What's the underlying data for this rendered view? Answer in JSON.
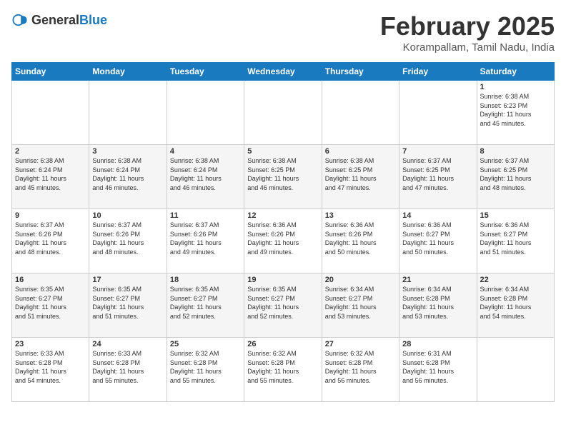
{
  "header": {
    "logo_general": "General",
    "logo_blue": "Blue",
    "title": "February 2025",
    "subtitle": "Korampallam, Tamil Nadu, India"
  },
  "weekdays": [
    "Sunday",
    "Monday",
    "Tuesday",
    "Wednesday",
    "Thursday",
    "Friday",
    "Saturday"
  ],
  "weeks": [
    [
      {
        "day": "",
        "info": ""
      },
      {
        "day": "",
        "info": ""
      },
      {
        "day": "",
        "info": ""
      },
      {
        "day": "",
        "info": ""
      },
      {
        "day": "",
        "info": ""
      },
      {
        "day": "",
        "info": ""
      },
      {
        "day": "1",
        "info": "Sunrise: 6:38 AM\nSunset: 6:23 PM\nDaylight: 11 hours\nand 45 minutes."
      }
    ],
    [
      {
        "day": "2",
        "info": "Sunrise: 6:38 AM\nSunset: 6:24 PM\nDaylight: 11 hours\nand 45 minutes."
      },
      {
        "day": "3",
        "info": "Sunrise: 6:38 AM\nSunset: 6:24 PM\nDaylight: 11 hours\nand 46 minutes."
      },
      {
        "day": "4",
        "info": "Sunrise: 6:38 AM\nSunset: 6:24 PM\nDaylight: 11 hours\nand 46 minutes."
      },
      {
        "day": "5",
        "info": "Sunrise: 6:38 AM\nSunset: 6:25 PM\nDaylight: 11 hours\nand 46 minutes."
      },
      {
        "day": "6",
        "info": "Sunrise: 6:38 AM\nSunset: 6:25 PM\nDaylight: 11 hours\nand 47 minutes."
      },
      {
        "day": "7",
        "info": "Sunrise: 6:37 AM\nSunset: 6:25 PM\nDaylight: 11 hours\nand 47 minutes."
      },
      {
        "day": "8",
        "info": "Sunrise: 6:37 AM\nSunset: 6:25 PM\nDaylight: 11 hours\nand 48 minutes."
      }
    ],
    [
      {
        "day": "9",
        "info": "Sunrise: 6:37 AM\nSunset: 6:26 PM\nDaylight: 11 hours\nand 48 minutes."
      },
      {
        "day": "10",
        "info": "Sunrise: 6:37 AM\nSunset: 6:26 PM\nDaylight: 11 hours\nand 48 minutes."
      },
      {
        "day": "11",
        "info": "Sunrise: 6:37 AM\nSunset: 6:26 PM\nDaylight: 11 hours\nand 49 minutes."
      },
      {
        "day": "12",
        "info": "Sunrise: 6:36 AM\nSunset: 6:26 PM\nDaylight: 11 hours\nand 49 minutes."
      },
      {
        "day": "13",
        "info": "Sunrise: 6:36 AM\nSunset: 6:26 PM\nDaylight: 11 hours\nand 50 minutes."
      },
      {
        "day": "14",
        "info": "Sunrise: 6:36 AM\nSunset: 6:27 PM\nDaylight: 11 hours\nand 50 minutes."
      },
      {
        "day": "15",
        "info": "Sunrise: 6:36 AM\nSunset: 6:27 PM\nDaylight: 11 hours\nand 51 minutes."
      }
    ],
    [
      {
        "day": "16",
        "info": "Sunrise: 6:35 AM\nSunset: 6:27 PM\nDaylight: 11 hours\nand 51 minutes."
      },
      {
        "day": "17",
        "info": "Sunrise: 6:35 AM\nSunset: 6:27 PM\nDaylight: 11 hours\nand 51 minutes."
      },
      {
        "day": "18",
        "info": "Sunrise: 6:35 AM\nSunset: 6:27 PM\nDaylight: 11 hours\nand 52 minutes."
      },
      {
        "day": "19",
        "info": "Sunrise: 6:35 AM\nSunset: 6:27 PM\nDaylight: 11 hours\nand 52 minutes."
      },
      {
        "day": "20",
        "info": "Sunrise: 6:34 AM\nSunset: 6:27 PM\nDaylight: 11 hours\nand 53 minutes."
      },
      {
        "day": "21",
        "info": "Sunrise: 6:34 AM\nSunset: 6:28 PM\nDaylight: 11 hours\nand 53 minutes."
      },
      {
        "day": "22",
        "info": "Sunrise: 6:34 AM\nSunset: 6:28 PM\nDaylight: 11 hours\nand 54 minutes."
      }
    ],
    [
      {
        "day": "23",
        "info": "Sunrise: 6:33 AM\nSunset: 6:28 PM\nDaylight: 11 hours\nand 54 minutes."
      },
      {
        "day": "24",
        "info": "Sunrise: 6:33 AM\nSunset: 6:28 PM\nDaylight: 11 hours\nand 55 minutes."
      },
      {
        "day": "25",
        "info": "Sunrise: 6:32 AM\nSunset: 6:28 PM\nDaylight: 11 hours\nand 55 minutes."
      },
      {
        "day": "26",
        "info": "Sunrise: 6:32 AM\nSunset: 6:28 PM\nDaylight: 11 hours\nand 55 minutes."
      },
      {
        "day": "27",
        "info": "Sunrise: 6:32 AM\nSunset: 6:28 PM\nDaylight: 11 hours\nand 56 minutes."
      },
      {
        "day": "28",
        "info": "Sunrise: 6:31 AM\nSunset: 6:28 PM\nDaylight: 11 hours\nand 56 minutes."
      },
      {
        "day": "",
        "info": ""
      }
    ]
  ]
}
